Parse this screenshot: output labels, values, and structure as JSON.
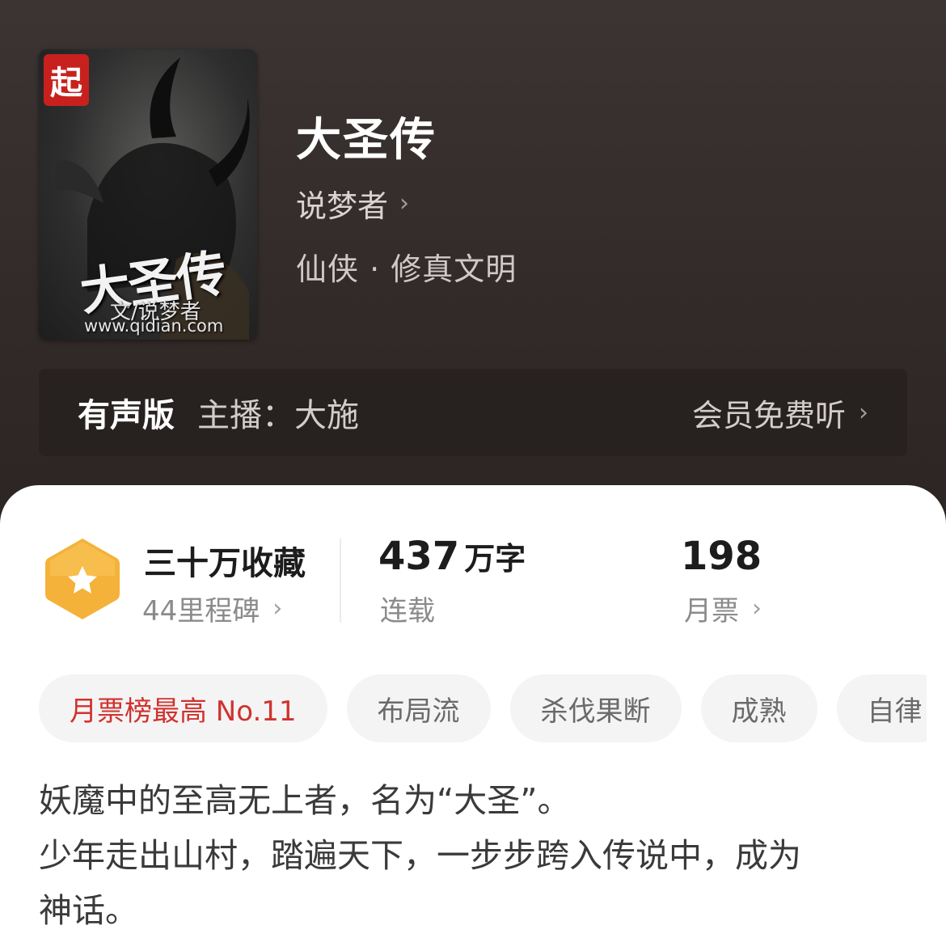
{
  "book": {
    "title": "大圣传",
    "author": "说梦者",
    "genre": "仙侠 · 修真文明",
    "cover": {
      "logo_char": "起",
      "title_text": "大圣传",
      "author_text": "文/说梦者",
      "site_text": "www.qidian.com"
    }
  },
  "audio": {
    "label": "有声版",
    "host": "主播：大施",
    "action": "会员免费听"
  },
  "stats": {
    "collection_title": "三十万收藏",
    "collection_sub": "44里程碑",
    "words_number": "437",
    "words_unit": "万字",
    "words_sub": "连载",
    "tickets_number": "198",
    "tickets_sub": "月票"
  },
  "tags": [
    {
      "label": "月票榜最高 No.11",
      "highlight": true
    },
    {
      "label": "布局流",
      "highlight": false
    },
    {
      "label": "杀伐果断",
      "highlight": false
    },
    {
      "label": "成熟",
      "highlight": false
    },
    {
      "label": "自律",
      "highlight": false
    }
  ],
  "description": [
    "妖魔中的至高无上者，名为“大圣”。",
    "少年走出山村，踏遍天下，一步步跨入传说中，成为",
    "神话。"
  ],
  "icons": {
    "chevron": "chevron-right-icon",
    "badge": "star-hexagon-icon"
  },
  "colors": {
    "header_bg": "#322b29",
    "audio_bg": "#27211f",
    "badge_gold": "#f4b23a",
    "hot_tag": "#d0322e"
  }
}
